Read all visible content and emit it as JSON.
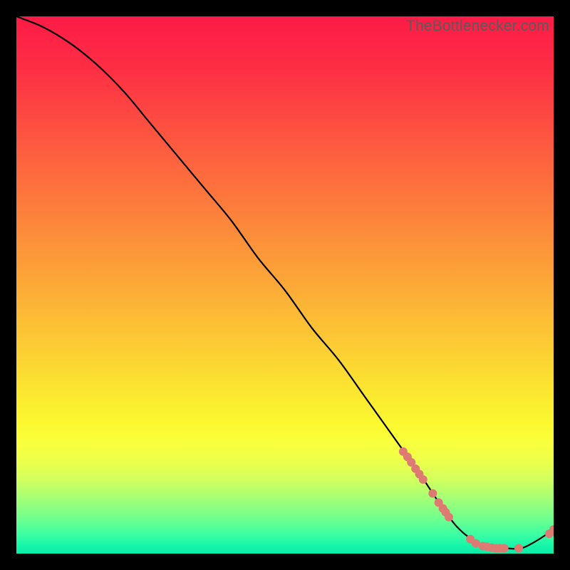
{
  "watermark": "TheBottlenecker.com",
  "chart_data": {
    "type": "line",
    "title": "",
    "xlabel": "",
    "ylabel": "",
    "xlim": [
      0,
      100
    ],
    "ylim": [
      0,
      100
    ],
    "grid": false,
    "legend": false,
    "series": [
      {
        "name": "bottleneck-curve",
        "color": "#000000",
        "x": [
          0,
          5,
          10,
          15,
          20,
          25,
          30,
          35,
          40,
          45,
          50,
          55,
          60,
          65,
          70,
          72.5,
          75,
          79,
          82,
          85,
          88,
          91,
          94,
          97,
          100
        ],
        "y": [
          100,
          98,
          95,
          91,
          86,
          80,
          74,
          68,
          62,
          55,
          49,
          42,
          36,
          29,
          22,
          18.5,
          15,
          9,
          5,
          2.5,
          1.2,
          1,
          1,
          2.5,
          4.5
        ]
      }
    ],
    "markers": [
      {
        "x": 72.0,
        "y": 19.0
      },
      {
        "x": 72.8,
        "y": 18.0
      },
      {
        "x": 73.5,
        "y": 17.0
      },
      {
        "x": 74.3,
        "y": 15.8
      },
      {
        "x": 75.0,
        "y": 14.8
      },
      {
        "x": 75.7,
        "y": 13.8
      },
      {
        "x": 77.5,
        "y": 11.2
      },
      {
        "x": 78.6,
        "y": 9.5
      },
      {
        "x": 79.4,
        "y": 8.4
      },
      {
        "x": 79.9,
        "y": 7.7
      },
      {
        "x": 80.5,
        "y": 6.8
      },
      {
        "x": 84.5,
        "y": 2.7
      },
      {
        "x": 85.5,
        "y": 1.9
      },
      {
        "x": 86.8,
        "y": 1.4
      },
      {
        "x": 87.6,
        "y": 1.3
      },
      {
        "x": 88.5,
        "y": 1.1
      },
      {
        "x": 89.3,
        "y": 1.0
      },
      {
        "x": 90.0,
        "y": 1.0
      },
      {
        "x": 90.8,
        "y": 1.0
      },
      {
        "x": 93.5,
        "y": 1.0
      },
      {
        "x": 99.2,
        "y": 3.7
      },
      {
        "x": 100.0,
        "y": 4.5
      }
    ],
    "marker_style": {
      "color": "#dd7a72",
      "radius_px": 6
    },
    "gradient_stops": [
      {
        "offset": 0.0,
        "color": "#fd1b47"
      },
      {
        "offset": 0.1,
        "color": "#fd2f44"
      },
      {
        "offset": 0.2,
        "color": "#fd4e41"
      },
      {
        "offset": 0.3,
        "color": "#fd6c3d"
      },
      {
        "offset": 0.4,
        "color": "#fc8b3a"
      },
      {
        "offset": 0.5,
        "color": "#fca937"
      },
      {
        "offset": 0.6,
        "color": "#fcc834"
      },
      {
        "offset": 0.7,
        "color": "#fbe730"
      },
      {
        "offset": 0.76,
        "color": "#fbf930"
      },
      {
        "offset": 0.79,
        "color": "#faff3b"
      },
      {
        "offset": 0.825,
        "color": "#eeff4a"
      },
      {
        "offset": 0.86,
        "color": "#d4ff5c"
      },
      {
        "offset": 0.9,
        "color": "#a0ff77"
      },
      {
        "offset": 0.935,
        "color": "#6fff8e"
      },
      {
        "offset": 0.965,
        "color": "#3affa4"
      },
      {
        "offset": 0.985,
        "color": "#16f6a9"
      },
      {
        "offset": 1.0,
        "color": "#0ceaa8"
      }
    ]
  }
}
